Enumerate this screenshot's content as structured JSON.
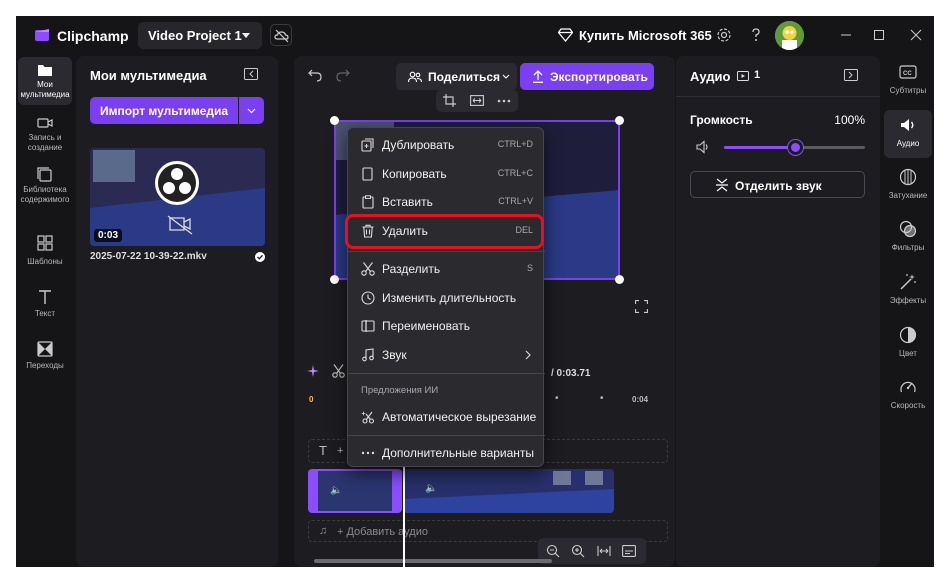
{
  "app": {
    "name": "Clipchamp",
    "project": "Video Project 1",
    "buy": "Купить Microsoft 365"
  },
  "left_rail": [
    {
      "label": "Мои мультимедиа",
      "icon": "folder-icon"
    },
    {
      "label": "Запись и создание",
      "icon": "camera-icon"
    },
    {
      "label": "Библиотека содержимого",
      "icon": "library-icon"
    },
    {
      "label": "Шаблоны",
      "icon": "templates-icon"
    },
    {
      "label": "Текст",
      "icon": "text-icon"
    },
    {
      "label": "Переходы",
      "icon": "transitions-icon"
    }
  ],
  "media": {
    "title": "Мои мультимедиа",
    "import_label": "Импорт мультимедиа",
    "item": {
      "duration": "0:03",
      "name": "2025-07-22 10-39-22.mkv"
    }
  },
  "editor": {
    "share_label": "Поделиться",
    "export_label": "Экспортировать",
    "timecode": "/ 0:03.71",
    "ruler": [
      "0",
      "0:04"
    ],
    "add_audio": "+ Добавить аудио"
  },
  "context_menu": {
    "items": [
      {
        "label": "Дублировать",
        "shortcut": "CTRL+D",
        "icon": "duplicate-icon"
      },
      {
        "label": "Копировать",
        "shortcut": "CTRL+C",
        "icon": "copy-icon"
      },
      {
        "label": "Вставить",
        "shortcut": "CTRL+V",
        "icon": "paste-icon"
      },
      {
        "label": "Удалить",
        "shortcut": "DEL",
        "icon": "trash-icon"
      },
      {
        "label": "Разделить",
        "shortcut": "S",
        "icon": "scissors-icon"
      },
      {
        "label": "Изменить длительность",
        "shortcut": "",
        "icon": "clock-icon"
      },
      {
        "label": "Переименовать",
        "shortcut": "",
        "icon": "rename-icon"
      },
      {
        "label": "Звук",
        "shortcut": "",
        "icon": "music-icon"
      }
    ],
    "ai_section": "Предложения ИИ",
    "ai_item": "Автоматическое вырезание",
    "more": "Дополнительные варианты"
  },
  "audio_panel": {
    "title": "Аудио",
    "badge": "1",
    "volume_label": "Громкость",
    "volume_value": "100%",
    "volume_level": 0.5,
    "detach_label": "Отделить звук"
  },
  "right_rail": [
    {
      "label": "Субтитры",
      "icon": "captions-icon"
    },
    {
      "label": "Аудио",
      "icon": "speaker-icon"
    },
    {
      "label": "Затухание",
      "icon": "fade-icon"
    },
    {
      "label": "Фильтры",
      "icon": "filters-icon"
    },
    {
      "label": "Эффекты",
      "icon": "effects-icon"
    },
    {
      "label": "Цвет",
      "icon": "color-icon"
    },
    {
      "label": "Скорость",
      "icon": "speed-icon"
    }
  ]
}
